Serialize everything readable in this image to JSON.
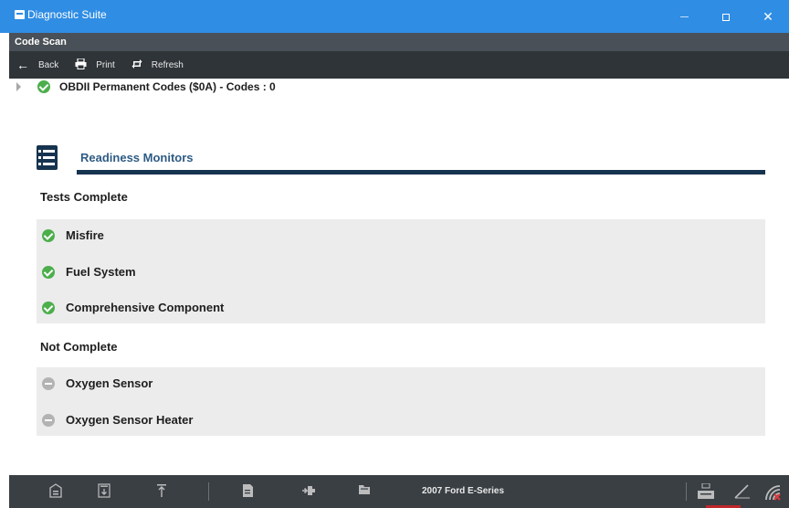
{
  "window": {
    "title": "Diagnostic Suite",
    "minimize_label": "",
    "maximize_label": "",
    "close_label": "✕"
  },
  "subheader": {
    "title": "Code Scan"
  },
  "toolbar": {
    "back_label": "Back",
    "print_label": "Print",
    "refresh_label": "Refresh"
  },
  "permanent_codes": {
    "label": "OBDII Permanent Codes ($0A) -  Codes : 0"
  },
  "readiness": {
    "title": "Readiness Monitors",
    "complete_title": "Tests Complete",
    "complete_items": [
      "Misfire",
      "Fuel System",
      "Comprehensive Component"
    ],
    "not_complete_title": "Not Complete",
    "not_complete_items": [
      "Oxygen Sensor",
      "Oxygen Sensor Heater"
    ]
  },
  "taskbar": {
    "vehicle": "2007 Ford E-Series"
  },
  "colors": {
    "titlebar": "#2f8de4",
    "toolbar": "#2f3439",
    "accent_navy": "#16334f",
    "ok_green": "#4cae4c",
    "row_bg": "#ececec"
  }
}
